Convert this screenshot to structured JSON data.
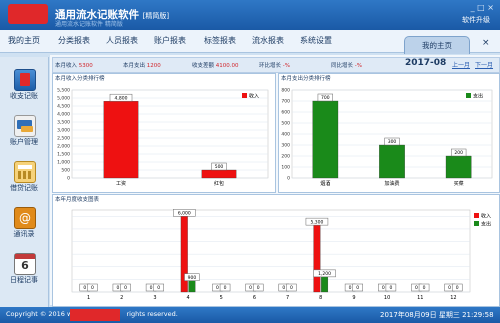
{
  "app": {
    "title": "通用流水记账软件",
    "edition": "[精简版]",
    "subtitle": "通用流水记账软件 精简版",
    "window_controls": "_ □ ×",
    "register_link": "软件升级"
  },
  "menu": [
    "我的主页",
    "分类报表",
    "人员报表",
    "账户报表",
    "标签报表",
    "流水报表",
    "系统设置"
  ],
  "home_tab": {
    "label": "我的主页",
    "close": "×"
  },
  "sidebar": [
    {
      "label": "收支记账",
      "icon": "ledger-icon",
      "color": "#e0282a"
    },
    {
      "label": "账户管理",
      "icon": "account-card-icon",
      "color": "#2f6fb8"
    },
    {
      "label": "借贷记账",
      "icon": "calculator-icon",
      "color": "#e8a93a"
    },
    {
      "label": "通讯录",
      "icon": "contacts-icon",
      "color": "#e08a1a"
    },
    {
      "label": "日程记事",
      "icon": "calendar-icon",
      "color": "#c23a3a"
    }
  ],
  "stats": [
    {
      "label": "本月收入",
      "value": "5300"
    },
    {
      "label": "本月支出",
      "value": "1200"
    },
    {
      "label": "收支差额",
      "value": "4100.00"
    },
    {
      "label": "环比增长",
      "value": "-%"
    },
    {
      "label": "同比增长",
      "value": "-%"
    }
  ],
  "month": {
    "label": "2017-08",
    "prev": "上一月",
    "next": "下一月"
  },
  "chart_data": [
    {
      "id": "income_chart",
      "type": "bar",
      "title": "本月收入分类排行榜",
      "categories": [
        "工资",
        "红包"
      ],
      "series": [
        {
          "name": "收入",
          "values": [
            4800,
            500
          ],
          "color": "#ee1111"
        }
      ],
      "ylim": [
        0,
        5500
      ],
      "yticks": [
        0,
        500,
        1000,
        1500,
        2000,
        2500,
        3000,
        3500,
        4000,
        4500,
        5000,
        5500
      ],
      "grid": true,
      "legend": "top-right"
    },
    {
      "id": "expense_chart",
      "type": "bar",
      "title": "本月支出分类排行榜",
      "categories": [
        "烟酒",
        "加油费",
        "买菜"
      ],
      "series": [
        {
          "name": "支出",
          "values": [
            700,
            300,
            200
          ],
          "color": "#1a8a1a"
        }
      ],
      "ylim": [
        0,
        800
      ],
      "yticks": [
        0,
        100,
        200,
        300,
        400,
        500,
        600,
        700,
        800
      ],
      "grid": true,
      "legend": "top-right"
    },
    {
      "id": "annual_chart",
      "type": "bar",
      "title": "本年月度收支图表",
      "categories": [
        "1",
        "2",
        "3",
        "4",
        "5",
        "6",
        "7",
        "8",
        "9",
        "10",
        "11",
        "12"
      ],
      "series": [
        {
          "name": "收入",
          "values": [
            0,
            0,
            0,
            6000,
            0,
            0,
            0,
            5300,
            0,
            0,
            0,
            0
          ],
          "color": "#ee1111"
        },
        {
          "name": "支出",
          "values": [
            0,
            0,
            0,
            900,
            0,
            0,
            0,
            1200,
            0,
            0,
            0,
            0
          ],
          "color": "#1a8a1a"
        }
      ],
      "ylim": [
        0,
        6500
      ],
      "grid": true,
      "legend": "top-right"
    }
  ],
  "status": {
    "copyright": "Copyright © 2016 w",
    "copyright_tail": "rights reserved.",
    "datetime": "2017年08月09日 星期三 21:29:58"
  }
}
